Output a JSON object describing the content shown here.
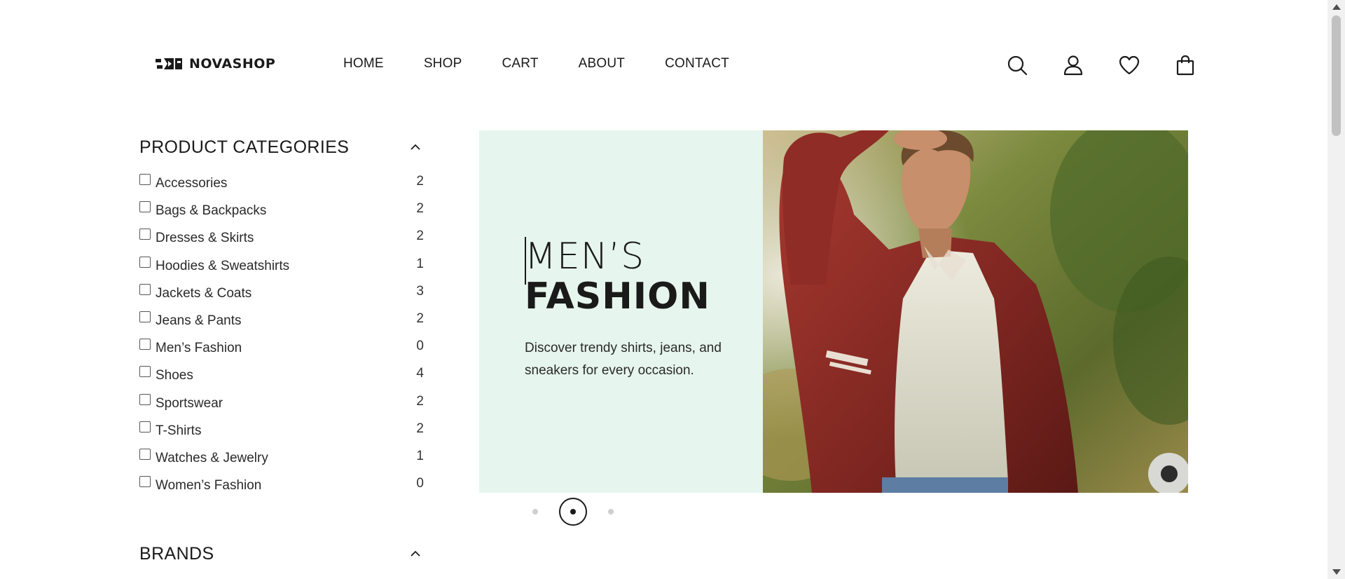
{
  "brand": {
    "name": "NOVASHOP"
  },
  "nav": [
    {
      "label": "HOME"
    },
    {
      "label": "SHOP"
    },
    {
      "label": "CART"
    },
    {
      "label": "ABOUT"
    },
    {
      "label": "CONTACT"
    }
  ],
  "header_icons": [
    "search-icon",
    "user-icon",
    "heart-icon",
    "shopping-bag-icon"
  ],
  "sidebar": {
    "categories_title": "PRODUCT CATEGORIES",
    "categories": [
      {
        "label": "Accessories",
        "count": "2"
      },
      {
        "label": "Bags & Backpacks",
        "count": "2"
      },
      {
        "label": "Dresses & Skirts",
        "count": "2"
      },
      {
        "label": "Hoodies & Sweatshirts",
        "count": "1"
      },
      {
        "label": "Jackets & Coats",
        "count": "3"
      },
      {
        "label": "Jeans & Pants",
        "count": "2"
      },
      {
        "label": "Men’s Fashion",
        "count": "0"
      },
      {
        "label": "Shoes",
        "count": "4"
      },
      {
        "label": "Sportswear",
        "count": "2"
      },
      {
        "label": "T-Shirts",
        "count": "2"
      },
      {
        "label": "Watches & Jewelry",
        "count": "1"
      },
      {
        "label": "Women’s Fashion",
        "count": "0"
      }
    ],
    "brands_title": "BRANDS"
  },
  "hero": {
    "line1": "MEN’S",
    "line2": "FASHION",
    "description": "Discover trendy shirts, jeans, and sneakers for every occasion.",
    "background_color": "#e6f5ee"
  },
  "carousel": {
    "slides": 3,
    "active_index": 1
  }
}
